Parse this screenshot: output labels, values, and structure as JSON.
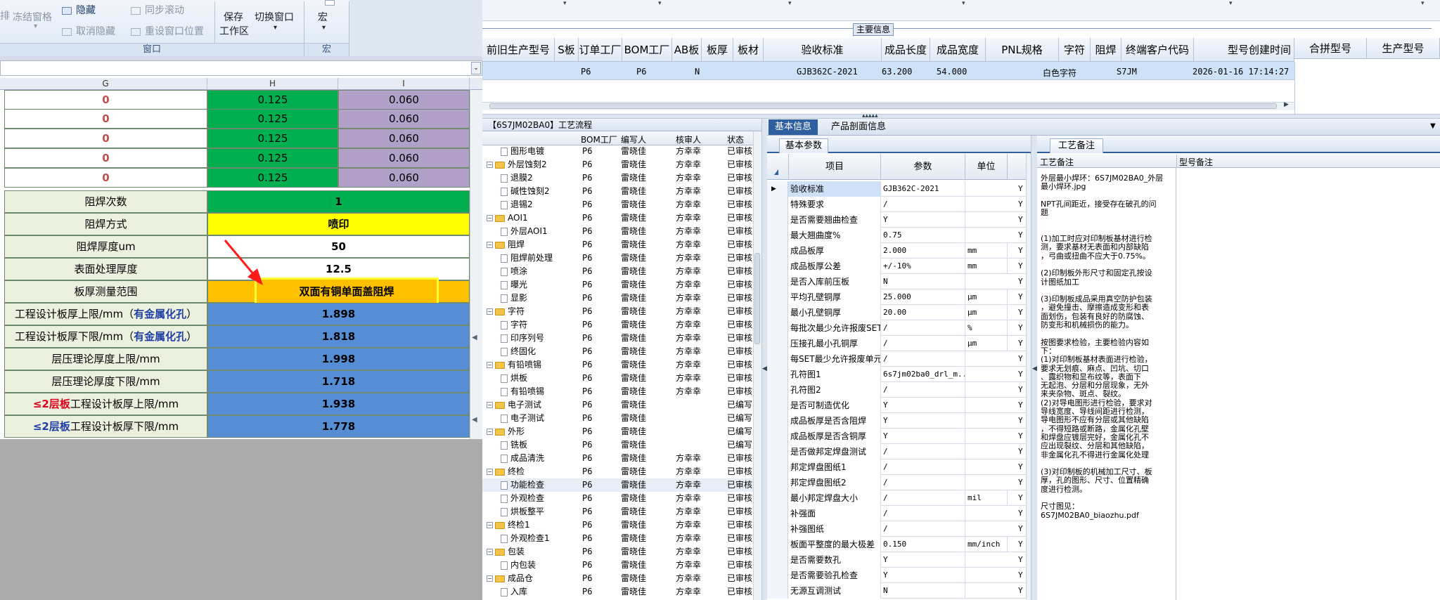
{
  "ribbon": {
    "b1": "排",
    "b2": "冻结窗格",
    "b3": "隐藏",
    "b4": "取消隐藏",
    "b5": "同步滚动",
    "b6": "重设窗口位置",
    "b7": "保存",
    "b8": "工作区",
    "b9": "切换窗口",
    "b10": "宏",
    "grp_window": "窗口",
    "grp_macro": "宏"
  },
  "sheet": {
    "col_g": "G",
    "col_h": "H",
    "col_i": "I",
    "top_rows": [
      [
        "0",
        "0.125",
        "0.060"
      ],
      [
        "0",
        "0.125",
        "0.060"
      ],
      [
        "0",
        "0.125",
        "0.060"
      ],
      [
        "0",
        "0.125",
        "0.060"
      ],
      [
        "0",
        "0.125",
        "0.060"
      ]
    ],
    "rows": [
      {
        "label": "阻焊次数",
        "value": "1"
      },
      {
        "label": "阻焊方式",
        "value": "喷印"
      },
      {
        "label": "阻焊厚度um",
        "value": "50"
      },
      {
        "label": "表面处理厚度",
        "value": "12.5"
      },
      {
        "label": "板厚测量范围",
        "value": "双面有铜单面盖阻焊"
      },
      {
        "label": "工程设计板厚上限/mm（",
        "label2": "有金属化孔",
        "label3": "）",
        "value": "1.898"
      },
      {
        "label": "工程设计板厚下限/mm（",
        "label2": "有金属化孔",
        "label3": "）",
        "value": "1.818"
      },
      {
        "label": "层压理论厚度上限/mm",
        "value": "1.998"
      },
      {
        "label": "层压理论厚度下限/mm",
        "value": "1.718"
      },
      {
        "label": "≤2层板",
        "label2": "工程设计板厚上限/mm",
        "value": "1.938"
      },
      {
        "label": "≤2层板",
        "label2": "工程设计板厚下限/mm",
        "value": "1.778"
      }
    ]
  },
  "main_info": {
    "section_label": "主要信息",
    "columns": [
      "前旧生产型号",
      "S板",
      "订单工厂",
      "BOM工厂",
      "AB板",
      "板厚",
      "板材",
      "验收标准",
      "成品长度",
      "成品宽度",
      "PNL规格",
      "字符",
      "阻焊",
      "终端客户代码",
      "型号创建时间"
    ],
    "row": {
      "order_factory": "P6",
      "bom_factory": "P6",
      "ab": "N",
      "standard": "GJB362C-2021",
      "length": "63.200",
      "width": "54.000",
      "char": "白色字符",
      "customer": "S7JM",
      "created": "2026-01-16 17:14:27"
    },
    "side_columns": [
      "合拼型号",
      "生产型号"
    ]
  },
  "flow": {
    "title": "【6S7JM02BA0】工艺流程",
    "col_bom": "BOM工厂",
    "col_writer": "编写人",
    "col_auditor": "核审人",
    "col_status": "状态",
    "rows": [
      {
        "indent": 2,
        "type": "doc",
        "name": "图形电镀",
        "bom": "P6",
        "w": "雷晓佳",
        "a": "方幸幸",
        "s": "已审核"
      },
      {
        "indent": 1,
        "type": "folder",
        "name": "外层蚀刻2",
        "bom": "P6",
        "w": "雷晓佳",
        "a": "方幸幸",
        "s": "已审核"
      },
      {
        "indent": 2,
        "type": "doc",
        "name": "退膜2",
        "bom": "P6",
        "w": "雷晓佳",
        "a": "方幸幸",
        "s": "已审核"
      },
      {
        "indent": 2,
        "type": "doc",
        "name": "碱性蚀刻2",
        "bom": "P6",
        "w": "雷晓佳",
        "a": "方幸幸",
        "s": "已审核"
      },
      {
        "indent": 2,
        "type": "doc",
        "name": "退锡2",
        "bom": "P6",
        "w": "雷晓佳",
        "a": "方幸幸",
        "s": "已审核"
      },
      {
        "indent": 1,
        "type": "folder",
        "name": "AOI1",
        "bom": "P6",
        "w": "雷晓佳",
        "a": "方幸幸",
        "s": "已审核"
      },
      {
        "indent": 2,
        "type": "doc",
        "name": "外层AOI1",
        "bom": "P6",
        "w": "雷晓佳",
        "a": "方幸幸",
        "s": "已审核"
      },
      {
        "indent": 1,
        "type": "folder",
        "name": "阻焊",
        "bom": "P6",
        "w": "雷晓佳",
        "a": "方幸幸",
        "s": "已审核"
      },
      {
        "indent": 2,
        "type": "doc",
        "name": "阻焊前处理",
        "bom": "P6",
        "w": "雷晓佳",
        "a": "方幸幸",
        "s": "已审核"
      },
      {
        "indent": 2,
        "type": "doc",
        "name": "喷涂",
        "bom": "P6",
        "w": "雷晓佳",
        "a": "方幸幸",
        "s": "已审核"
      },
      {
        "indent": 2,
        "type": "doc",
        "name": "曝光",
        "bom": "P6",
        "w": "雷晓佳",
        "a": "方幸幸",
        "s": "已审核"
      },
      {
        "indent": 2,
        "type": "doc",
        "name": "显影",
        "bom": "P6",
        "w": "雷晓佳",
        "a": "方幸幸",
        "s": "已审核"
      },
      {
        "indent": 1,
        "type": "folder",
        "name": "字符",
        "bom": "P6",
        "w": "雷晓佳",
        "a": "方幸幸",
        "s": "已审核"
      },
      {
        "indent": 2,
        "type": "doc",
        "name": "字符",
        "bom": "P6",
        "w": "雷晓佳",
        "a": "方幸幸",
        "s": "已审核"
      },
      {
        "indent": 2,
        "type": "doc",
        "name": "印序列号",
        "bom": "P6",
        "w": "雷晓佳",
        "a": "方幸幸",
        "s": "已审核"
      },
      {
        "indent": 2,
        "type": "doc",
        "name": "终固化",
        "bom": "P6",
        "w": "雷晓佳",
        "a": "方幸幸",
        "s": "已审核"
      },
      {
        "indent": 1,
        "type": "folder",
        "name": "有铅喷锡",
        "bom": "P6",
        "w": "雷晓佳",
        "a": "方幸幸",
        "s": "已审核"
      },
      {
        "indent": 2,
        "type": "doc",
        "name": "烘板",
        "bom": "P6",
        "w": "雷晓佳",
        "a": "方幸幸",
        "s": "已审核"
      },
      {
        "indent": 2,
        "type": "doc",
        "name": "有铅喷锡",
        "bom": "P6",
        "w": "雷晓佳",
        "a": "方幸幸",
        "s": "已审核"
      },
      {
        "indent": 1,
        "type": "folder",
        "name": "电子测试",
        "bom": "P6",
        "w": "雷晓佳",
        "a": "",
        "s": "已编写"
      },
      {
        "indent": 2,
        "type": "doc",
        "name": "电子测试",
        "bom": "P6",
        "w": "雷晓佳",
        "a": "",
        "s": "已编写"
      },
      {
        "indent": 1,
        "type": "folder",
        "name": "外形",
        "bom": "P6",
        "w": "雷晓佳",
        "a": "",
        "s": "已编写"
      },
      {
        "indent": 2,
        "type": "doc",
        "name": "铣板",
        "bom": "P6",
        "w": "雷晓佳",
        "a": "",
        "s": "已编写"
      },
      {
        "indent": 2,
        "type": "doc",
        "name": "成品清洗",
        "bom": "P6",
        "w": "雷晓佳",
        "a": "方幸幸",
        "s": "已审核"
      },
      {
        "indent": 1,
        "type": "folder",
        "name": "终检",
        "bom": "P6",
        "w": "雷晓佳",
        "a": "方幸幸",
        "s": "已审核"
      },
      {
        "indent": 2,
        "type": "doc",
        "name": "功能检查",
        "bom": "P6",
        "w": "雷晓佳",
        "a": "方幸幸",
        "s": "已审核"
      },
      {
        "indent": 2,
        "type": "doc",
        "name": "外观检查",
        "bom": "P6",
        "w": "雷晓佳",
        "a": "方幸幸",
        "s": "已审核"
      },
      {
        "indent": 2,
        "type": "doc",
        "name": "烘板整平",
        "bom": "P6",
        "w": "雷晓佳",
        "a": "方幸幸",
        "s": "已审核"
      },
      {
        "indent": 1,
        "type": "folder",
        "name": "终检1",
        "bom": "P6",
        "w": "雷晓佳",
        "a": "方幸幸",
        "s": "已审核"
      },
      {
        "indent": 2,
        "type": "doc",
        "name": "外观检查1",
        "bom": "P6",
        "w": "雷晓佳",
        "a": "方幸幸",
        "s": "已审核"
      },
      {
        "indent": 1,
        "type": "folder",
        "name": "包装",
        "bom": "P6",
        "w": "雷晓佳",
        "a": "方幸幸",
        "s": "已审核"
      },
      {
        "indent": 2,
        "type": "doc",
        "name": "内包装",
        "bom": "P6",
        "w": "雷晓佳",
        "a": "方幸幸",
        "s": "已审核"
      },
      {
        "indent": 1,
        "type": "folder",
        "name": "成品仓",
        "bom": "P6",
        "w": "雷晓佳",
        "a": "方幸幸",
        "s": "已审核"
      },
      {
        "indent": 2,
        "type": "doc",
        "name": "入库",
        "bom": "P6",
        "w": "雷晓佳",
        "a": "方幸幸",
        "s": "已审核"
      }
    ]
  },
  "basic": {
    "tab_basic": "基本信息",
    "tab_profile": "产品剖面信息",
    "sub_tab": "基本参数",
    "col_item": "项目",
    "col_param": "参数",
    "col_unit": "单位",
    "rows": [
      [
        "验收标准",
        "GJB362C-2021",
        "",
        "Y"
      ],
      [
        "特殊要求",
        "/",
        "",
        "Y"
      ],
      [
        "是否需要翘曲检查",
        "Y",
        "",
        "Y"
      ],
      [
        "最大翘曲度%",
        "0.75",
        "",
        "Y"
      ],
      [
        "成品板厚",
        "2.000",
        "mm",
        "Y"
      ],
      [
        "成品板厚公差",
        "+/-10%",
        "mm",
        "Y"
      ],
      [
        "是否入库前压板",
        "N",
        "",
        "Y"
      ],
      [
        "平均孔壁铜厚",
        "25.000",
        "μm",
        "Y"
      ],
      [
        "最小孔壁铜厚",
        "20.00",
        "μm",
        "Y"
      ],
      [
        "每批次最少允许报废SET",
        "/",
        "%",
        "Y"
      ],
      [
        "压接孔最小孔铜厚",
        "/",
        "μm",
        "Y"
      ],
      [
        "每SET最少允许报废单元",
        "/",
        "",
        "Y"
      ],
      [
        "孔符图1",
        "6s7jm02ba0_drl_m...",
        "",
        "Y"
      ],
      [
        "孔符图2",
        "/",
        "",
        "Y"
      ],
      [
        "是否可制造优化",
        "Y",
        "",
        "Y"
      ],
      [
        "成品板厚是否含阻焊",
        "Y",
        "",
        "Y"
      ],
      [
        "成品板厚是否含铜厚",
        "Y",
        "",
        "Y"
      ],
      [
        "是否做邦定焊盘测试",
        "/",
        "",
        "Y"
      ],
      [
        "邦定焊盘图纸1",
        "/",
        "",
        "Y"
      ],
      [
        "邦定焊盘图纸2",
        "/",
        "",
        "Y"
      ],
      [
        "最小邦定焊盘大小",
        "/",
        "mil",
        "Y"
      ],
      [
        "补强面",
        "/",
        "",
        "Y"
      ],
      [
        "补强图纸",
        "/",
        "",
        "Y"
      ],
      [
        "板面平整度的最大极差",
        "0.150",
        "mm/inch",
        "Y"
      ],
      [
        "是否需要数孔",
        "Y",
        "",
        "Y"
      ],
      [
        "是否需要验孔检查",
        "Y",
        "",
        "Y"
      ],
      [
        "无源互调测试",
        "N",
        "",
        "Y"
      ]
    ]
  },
  "remarks": {
    "tab": "工艺备注",
    "col1": "工艺备注",
    "col2": "型号备注",
    "lines": [
      "外层最小焊环：6S7JM02BA0_外层",
      "最小焊环.jpg",
      "",
      "NPT孔间距近，接受存在破孔的问",
      "题",
      "",
      "",
      "(1)加工时应对印制板基材进行检",
      "测，要求基材无表面和内部缺陷",
      "，弓曲或扭曲不应大于0.75%。",
      "",
      "(2)印制板外形尺寸和固定孔按设",
      "计图纸加工",
      "",
      "(3)印制板成品采用真空防护包装",
      "，避免撞击、摩擦造成变形和表",
      "面划伤，包装有良好的防腐蚀、",
      "防变形和机械损伤的能力。",
      "",
      "按图要求检验，主要检验内容如",
      "下：",
      "(1)对印制板基材表面进行检验，",
      "要求无划痕、麻点、凹坑、切口",
      "、露织物和显布纹等，表面下",
      "无起泡、分层和分层现象，无外",
      "来夹杂物、斑点、裂纹。",
      "(2)对导电图形进行检验，要求对",
      "导线宽度、导线间距进行检测，",
      "导电图形不应有分层或其他缺陷",
      "，不得短路或断路，金属化孔壁",
      "和焊盘应镀层完好，金属化孔不",
      "应出现裂纹、分层和其他缺陷，",
      "非金属化孔不得进行金属化处理",
      "",
      "(3)对印制板的机械加工尺寸、板",
      "厚，孔的图形、尺寸、位置精确",
      "度进行检测。",
      "",
      "尺寸图见：",
      "6S7JM02BA0_biaozhu.pdf"
    ]
  },
  "colors": {
    "green": "#00b050",
    "purple": "#b1a0c7",
    "yellow": "#ffff00",
    "orange": "#ffc000",
    "blue": "#558ed5",
    "label_bg": "#ebf1de",
    "select": "#cfe0f7"
  }
}
